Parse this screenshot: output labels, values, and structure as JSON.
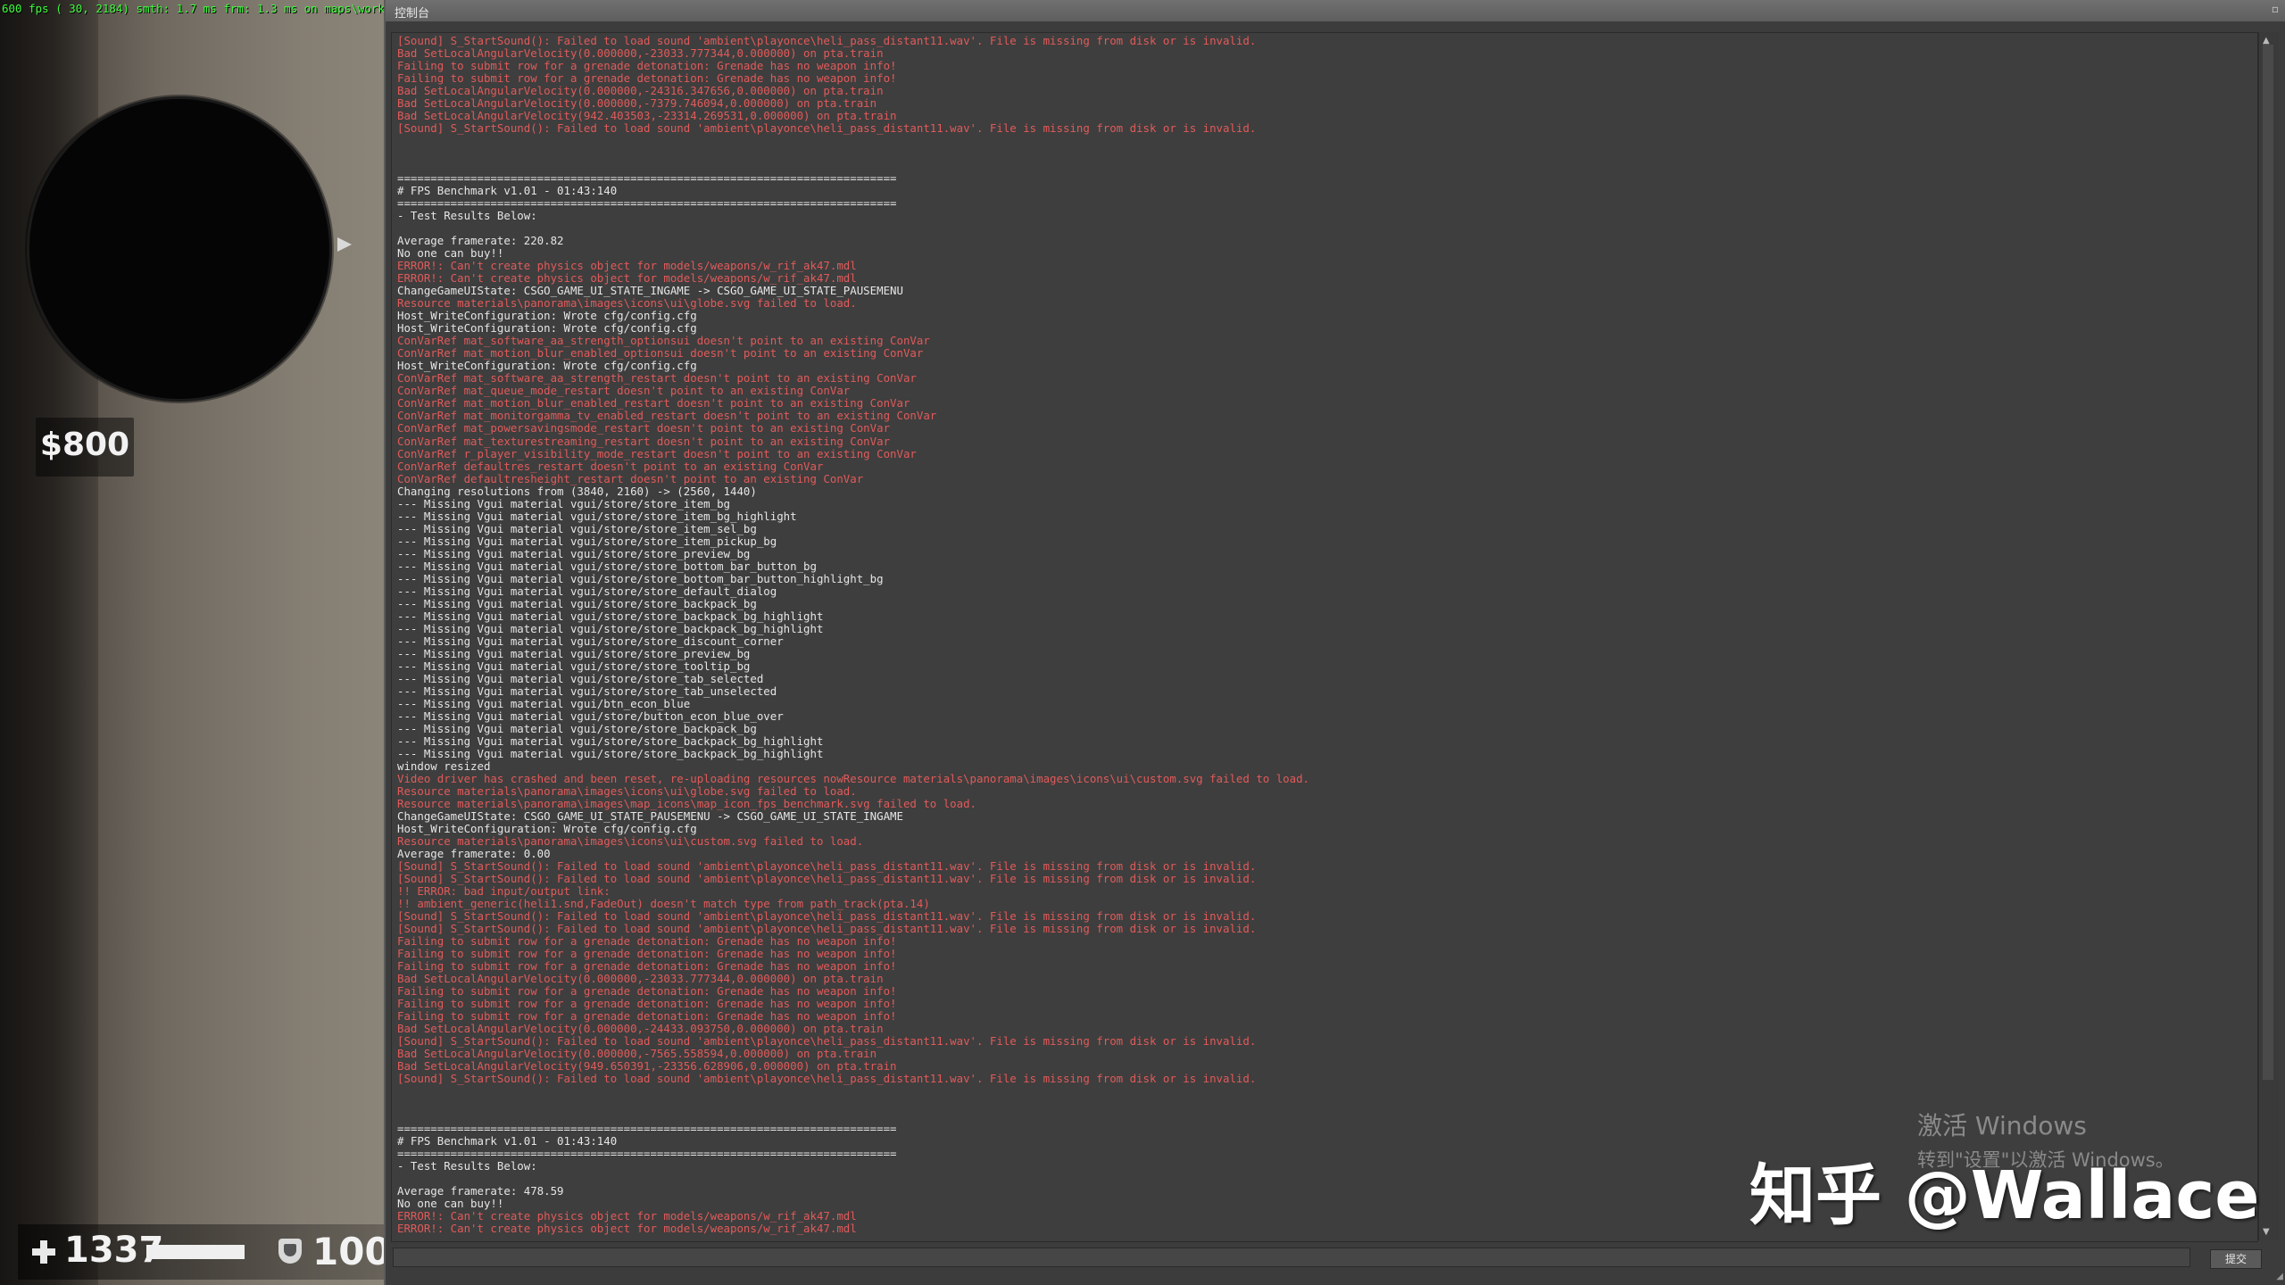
{
  "hud": {
    "fps_overlay": "600 fps ( 30, 2184) smth: 1.7 ms frm: 1.3 ms on maps\\workshop",
    "money": "$800",
    "health": "1337",
    "health_fraction": 1.0,
    "armor": "100",
    "icons": [
      "radar",
      "health-cross-icon",
      "armor-shield-icon",
      "radar-direction-arrow-icon"
    ]
  },
  "console": {
    "title": "控制台",
    "submit_label": "提交",
    "input_value": "",
    "colors": {
      "normal": "#e6e6e6",
      "error": "#e25a5a",
      "background": "#3e3e3e"
    },
    "lines": [
      {
        "t": "[Sound] S_StartSound(): Failed to load sound 'ambient\\playonce\\heli_pass_distant11.wav'. File is missing from disk or is invalid.",
        "c": "e"
      },
      {
        "t": "Bad SetLocalAngularVelocity(0.000000,-23033.777344,0.000000) on pta.train",
        "c": "e"
      },
      {
        "t": "Failing to submit row for a grenade detonation: Grenade has no weapon info!",
        "c": "e"
      },
      {
        "t": "Failing to submit row for a grenade detonation: Grenade has no weapon info!",
        "c": "e"
      },
      {
        "t": "Bad SetLocalAngularVelocity(0.000000,-24316.347656,0.000000) on pta.train",
        "c": "e"
      },
      {
        "t": "Bad SetLocalAngularVelocity(0.000000,-7379.746094,0.000000) on pta.train",
        "c": "e"
      },
      {
        "t": "Bad SetLocalAngularVelocity(942.403503,-23314.269531,0.000000) on pta.train",
        "c": "e"
      },
      {
        "t": "[Sound] S_StartSound(): Failed to load sound 'ambient\\playonce\\heli_pass_distant11.wav'. File is missing from disk or is invalid.",
        "c": "e"
      },
      {
        "t": "",
        "c": "n"
      },
      {
        "t": "",
        "c": "n"
      },
      {
        "t": "",
        "c": "n"
      },
      {
        "t": "===========================================================================",
        "c": "n"
      },
      {
        "t": "# FPS Benchmark v1.01 - 01:43:140",
        "c": "n"
      },
      {
        "t": "===========================================================================",
        "c": "n"
      },
      {
        "t": "- Test Results Below:",
        "c": "n"
      },
      {
        "t": "",
        "c": "n"
      },
      {
        "t": "Average framerate: 220.82",
        "c": "n"
      },
      {
        "t": "No one can buy!!",
        "c": "n"
      },
      {
        "t": "ERROR!: Can't create physics object for models/weapons/w_rif_ak47.mdl",
        "c": "e"
      },
      {
        "t": "ERROR!: Can't create physics object for models/weapons/w_rif_ak47.mdl",
        "c": "e"
      },
      {
        "t": "ChangeGameUIState: CSGO_GAME_UI_STATE_INGAME -> CSGO_GAME_UI_STATE_PAUSEMENU",
        "c": "n"
      },
      {
        "t": "Resource materials\\panorama\\images\\icons\\ui\\globe.svg failed to load.",
        "c": "e"
      },
      {
        "t": "Host_WriteConfiguration: Wrote cfg/config.cfg",
        "c": "n"
      },
      {
        "t": "Host_WriteConfiguration: Wrote cfg/config.cfg",
        "c": "n"
      },
      {
        "t": "ConVarRef mat_software_aa_strength_optionsui doesn't point to an existing ConVar",
        "c": "e"
      },
      {
        "t": "ConVarRef mat_motion_blur_enabled_optionsui doesn't point to an existing ConVar",
        "c": "e"
      },
      {
        "t": "Host_WriteConfiguration: Wrote cfg/config.cfg",
        "c": "n"
      },
      {
        "t": "ConVarRef mat_software_aa_strength_restart doesn't point to an existing ConVar",
        "c": "e"
      },
      {
        "t": "ConVarRef mat_queue_mode_restart doesn't point to an existing ConVar",
        "c": "e"
      },
      {
        "t": "ConVarRef mat_motion_blur_enabled_restart doesn't point to an existing ConVar",
        "c": "e"
      },
      {
        "t": "ConVarRef mat_monitorgamma_tv_enabled_restart doesn't point to an existing ConVar",
        "c": "e"
      },
      {
        "t": "ConVarRef mat_powersavingsmode_restart doesn't point to an existing ConVar",
        "c": "e"
      },
      {
        "t": "ConVarRef mat_texturestreaming_restart doesn't point to an existing ConVar",
        "c": "e"
      },
      {
        "t": "ConVarRef r_player_visibility_mode_restart doesn't point to an existing ConVar",
        "c": "e"
      },
      {
        "t": "ConVarRef defaultres_restart doesn't point to an existing ConVar",
        "c": "e"
      },
      {
        "t": "ConVarRef defaultresheight_restart doesn't point to an existing ConVar",
        "c": "e"
      },
      {
        "t": "Changing resolutions from (3840, 2160) -> (2560, 1440)",
        "c": "n"
      },
      {
        "t": "--- Missing Vgui material vgui/store/store_item_bg",
        "c": "n"
      },
      {
        "t": "--- Missing Vgui material vgui/store/store_item_bg_highlight",
        "c": "n"
      },
      {
        "t": "--- Missing Vgui material vgui/store/store_item_sel_bg",
        "c": "n"
      },
      {
        "t": "--- Missing Vgui material vgui/store/store_item_pickup_bg",
        "c": "n"
      },
      {
        "t": "--- Missing Vgui material vgui/store/store_preview_bg",
        "c": "n"
      },
      {
        "t": "--- Missing Vgui material vgui/store/store_bottom_bar_button_bg",
        "c": "n"
      },
      {
        "t": "--- Missing Vgui material vgui/store/store_bottom_bar_button_highlight_bg",
        "c": "n"
      },
      {
        "t": "--- Missing Vgui material vgui/store/store_default_dialog",
        "c": "n"
      },
      {
        "t": "--- Missing Vgui material vgui/store/store_backpack_bg",
        "c": "n"
      },
      {
        "t": "--- Missing Vgui material vgui/store/store_backpack_bg_highlight",
        "c": "n"
      },
      {
        "t": "--- Missing Vgui material vgui/store/store_backpack_bg_highlight",
        "c": "n"
      },
      {
        "t": "--- Missing Vgui material vgui/store/store_discount_corner",
        "c": "n"
      },
      {
        "t": "--- Missing Vgui material vgui/store/store_preview_bg",
        "c": "n"
      },
      {
        "t": "--- Missing Vgui material vgui/store/store_tooltip_bg",
        "c": "n"
      },
      {
        "t": "--- Missing Vgui material vgui/store/store_tab_selected",
        "c": "n"
      },
      {
        "t": "--- Missing Vgui material vgui/store/store_tab_unselected",
        "c": "n"
      },
      {
        "t": "--- Missing Vgui material vgui/btn_econ_blue",
        "c": "n"
      },
      {
        "t": "--- Missing Vgui material vgui/store/button_econ_blue_over",
        "c": "n"
      },
      {
        "t": "--- Missing Vgui material vgui/store/store_backpack_bg",
        "c": "n"
      },
      {
        "t": "--- Missing Vgui material vgui/store/store_backpack_bg_highlight",
        "c": "n"
      },
      {
        "t": "--- Missing Vgui material vgui/store/store_backpack_bg_highlight",
        "c": "n"
      },
      {
        "t": "window resized",
        "c": "n"
      },
      {
        "t": "Video driver has crashed and been reset, re-uploading resources nowResource materials\\panorama\\images\\icons\\ui\\custom.svg failed to load.",
        "c": "e"
      },
      {
        "t": "Resource materials\\panorama\\images\\icons\\ui\\globe.svg failed to load.",
        "c": "e"
      },
      {
        "t": "Resource materials\\panorama\\images\\map_icons\\map_icon_fps_benchmark.svg failed to load.",
        "c": "e"
      },
      {
        "t": "ChangeGameUIState: CSGO_GAME_UI_STATE_PAUSEMENU -> CSGO_GAME_UI_STATE_INGAME",
        "c": "n"
      },
      {
        "t": "Host_WriteConfiguration: Wrote cfg/config.cfg",
        "c": "n"
      },
      {
        "t": "Resource materials\\panorama\\images\\icons\\ui\\custom.svg failed to load.",
        "c": "e"
      },
      {
        "t": "Average framerate: 0.00",
        "c": "n"
      },
      {
        "t": "[Sound] S_StartSound(): Failed to load sound 'ambient\\playonce\\heli_pass_distant11.wav'. File is missing from disk or is invalid.",
        "c": "e"
      },
      {
        "t": "[Sound] S_StartSound(): Failed to load sound 'ambient\\playonce\\heli_pass_distant11.wav'. File is missing from disk or is invalid.",
        "c": "e"
      },
      {
        "t": "!! ERROR: bad input/output link:",
        "c": "e"
      },
      {
        "t": "!! ambient_generic(heli1.snd,FadeOut) doesn't match type from path_track(pta.14)",
        "c": "e"
      },
      {
        "t": "[Sound] S_StartSound(): Failed to load sound 'ambient\\playonce\\heli_pass_distant11.wav'. File is missing from disk or is invalid.",
        "c": "e"
      },
      {
        "t": "[Sound] S_StartSound(): Failed to load sound 'ambient\\playonce\\heli_pass_distant11.wav'. File is missing from disk or is invalid.",
        "c": "e"
      },
      {
        "t": "Failing to submit row for a grenade detonation: Grenade has no weapon info!",
        "c": "e"
      },
      {
        "t": "Failing to submit row for a grenade detonation: Grenade has no weapon info!",
        "c": "e"
      },
      {
        "t": "Failing to submit row for a grenade detonation: Grenade has no weapon info!",
        "c": "e"
      },
      {
        "t": "Bad SetLocalAngularVelocity(0.000000,-23033.777344,0.000000) on pta.train",
        "c": "e"
      },
      {
        "t": "Failing to submit row for a grenade detonation: Grenade has no weapon info!",
        "c": "e"
      },
      {
        "t": "Failing to submit row for a grenade detonation: Grenade has no weapon info!",
        "c": "e"
      },
      {
        "t": "Failing to submit row for a grenade detonation: Grenade has no weapon info!",
        "c": "e"
      },
      {
        "t": "Bad SetLocalAngularVelocity(0.000000,-24433.093750,0.000000) on pta.train",
        "c": "e"
      },
      {
        "t": "[Sound] S_StartSound(): Failed to load sound 'ambient\\playonce\\heli_pass_distant11.wav'. File is missing from disk or is invalid.",
        "c": "e"
      },
      {
        "t": "Bad SetLocalAngularVelocity(0.000000,-7565.558594,0.000000) on pta.train",
        "c": "e"
      },
      {
        "t": "Bad SetLocalAngularVelocity(949.650391,-23356.628906,0.000000) on pta.train",
        "c": "e"
      },
      {
        "t": "[Sound] S_StartSound(): Failed to load sound 'ambient\\playonce\\heli_pass_distant11.wav'. File is missing from disk or is invalid.",
        "c": "e"
      },
      {
        "t": "",
        "c": "n"
      },
      {
        "t": "",
        "c": "n"
      },
      {
        "t": "",
        "c": "n"
      },
      {
        "t": "===========================================================================",
        "c": "n"
      },
      {
        "t": "# FPS Benchmark v1.01 - 01:43:140",
        "c": "n"
      },
      {
        "t": "===========================================================================",
        "c": "n"
      },
      {
        "t": "- Test Results Below:",
        "c": "n"
      },
      {
        "t": "",
        "c": "n"
      },
      {
        "t": "Average framerate: 478.59",
        "c": "n"
      },
      {
        "t": "No one can buy!!",
        "c": "n"
      },
      {
        "t": "ERROR!: Can't create physics object for models/weapons/w_rif_ak47.mdl",
        "c": "e"
      },
      {
        "t": "ERROR!: Can't create physics object for models/weapons/w_rif_ak47.mdl",
        "c": "e"
      }
    ]
  },
  "watermarks": {
    "windows_activate_title": "激活 Windows",
    "windows_activate_sub": "转到\"设置\"以激活 Windows。",
    "zhihu": "知乎 @Wallace"
  }
}
